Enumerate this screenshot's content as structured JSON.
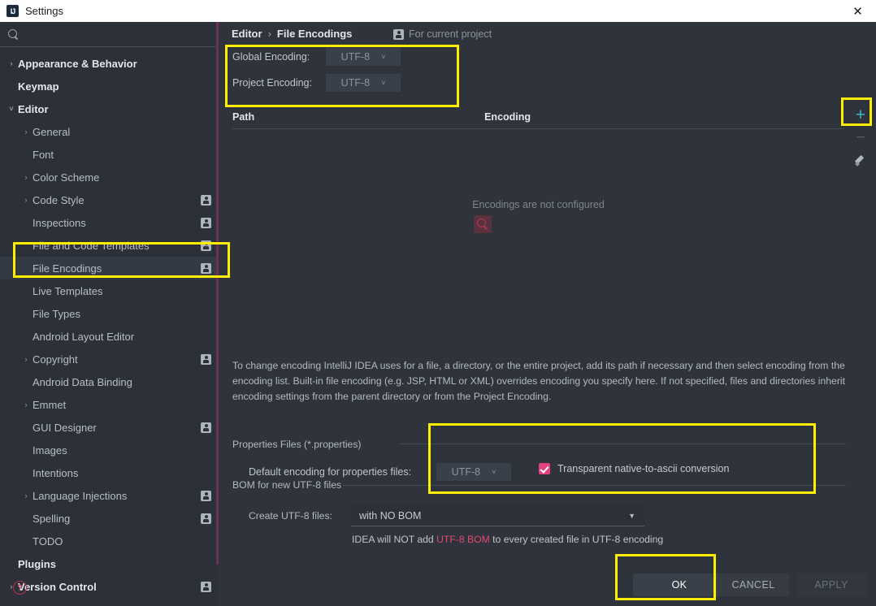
{
  "window": {
    "title": "Settings",
    "app_icon": "intellij-idea-icon",
    "close_icon": "close-icon"
  },
  "sidebar": {
    "search": {
      "value": "",
      "placeholder": "",
      "icon": "search-icon"
    },
    "items": [
      {
        "label": "Appearance & Behavior",
        "level": 0,
        "arrow": "›",
        "bold": true,
        "badge": false,
        "selected": false
      },
      {
        "label": "Keymap",
        "level": 0,
        "arrow": "",
        "bold": true,
        "badge": false,
        "selected": false
      },
      {
        "label": "Editor",
        "level": 0,
        "arrow": "˅",
        "bold": true,
        "badge": false,
        "selected": false
      },
      {
        "label": "General",
        "level": 1,
        "arrow": "›",
        "bold": false,
        "badge": false,
        "selected": false
      },
      {
        "label": "Font",
        "level": 1,
        "arrow": "",
        "bold": false,
        "badge": false,
        "selected": false
      },
      {
        "label": "Color Scheme",
        "level": 1,
        "arrow": "›",
        "bold": false,
        "badge": false,
        "selected": false
      },
      {
        "label": "Code Style",
        "level": 1,
        "arrow": "›",
        "bold": false,
        "badge": true,
        "selected": false
      },
      {
        "label": "Inspections",
        "level": 1,
        "arrow": "",
        "bold": false,
        "badge": true,
        "selected": false
      },
      {
        "label": "File and Code Templates",
        "level": 1,
        "arrow": "",
        "bold": false,
        "badge": true,
        "selected": false
      },
      {
        "label": "File Encodings",
        "level": 1,
        "arrow": "",
        "bold": false,
        "badge": true,
        "selected": true
      },
      {
        "label": "Live Templates",
        "level": 1,
        "arrow": "",
        "bold": false,
        "badge": false,
        "selected": false
      },
      {
        "label": "File Types",
        "level": 1,
        "arrow": "",
        "bold": false,
        "badge": false,
        "selected": false
      },
      {
        "label": "Android Layout Editor",
        "level": 1,
        "arrow": "",
        "bold": false,
        "badge": false,
        "selected": false
      },
      {
        "label": "Copyright",
        "level": 1,
        "arrow": "›",
        "bold": false,
        "badge": true,
        "selected": false
      },
      {
        "label": "Android Data Binding",
        "level": 1,
        "arrow": "",
        "bold": false,
        "badge": false,
        "selected": false
      },
      {
        "label": "Emmet",
        "level": 1,
        "arrow": "›",
        "bold": false,
        "badge": false,
        "selected": false
      },
      {
        "label": "GUI Designer",
        "level": 1,
        "arrow": "",
        "bold": false,
        "badge": true,
        "selected": false
      },
      {
        "label": "Images",
        "level": 1,
        "arrow": "",
        "bold": false,
        "badge": false,
        "selected": false
      },
      {
        "label": "Intentions",
        "level": 1,
        "arrow": "",
        "bold": false,
        "badge": false,
        "selected": false
      },
      {
        "label": "Language Injections",
        "level": 1,
        "arrow": "›",
        "bold": false,
        "badge": true,
        "selected": false
      },
      {
        "label": "Spelling",
        "level": 1,
        "arrow": "",
        "bold": false,
        "badge": true,
        "selected": false
      },
      {
        "label": "TODO",
        "level": 1,
        "arrow": "",
        "bold": false,
        "badge": false,
        "selected": false
      },
      {
        "label": "Plugins",
        "level": 0,
        "arrow": "",
        "bold": true,
        "badge": false,
        "selected": false
      },
      {
        "label": "Version Control",
        "level": 0,
        "arrow": "›",
        "bold": true,
        "badge": true,
        "selected": false
      }
    ],
    "help_icon": "help-icon",
    "help_glyph": "?"
  },
  "content": {
    "breadcrumb": {
      "parent": "Editor",
      "separator": "›",
      "current": "File Encodings"
    },
    "for_current_project": {
      "label": "For current project",
      "icon": "person-icon"
    },
    "global_encoding": {
      "label": "Global Encoding:",
      "value": "UTF-8",
      "chevron": "˅"
    },
    "project_encoding": {
      "label": "Project Encoding:",
      "value": "UTF-8",
      "chevron": "˅"
    },
    "table": {
      "columns": [
        "Path",
        "Encoding"
      ],
      "rows": [],
      "empty_message": "Encodings are not configured",
      "tools": [
        {
          "name": "add-encoding-button",
          "glyph": "+",
          "enabled": true
        },
        {
          "name": "remove-encoding-button",
          "glyph": "−",
          "enabled": false
        },
        {
          "name": "edit-encoding-button",
          "glyph": "pencil",
          "enabled": true
        }
      ]
    },
    "description": "To change encoding IntelliJ IDEA uses for a file, a directory, or the entire project, add its path if necessary and then select encoding from the encoding list. Built-in file encoding (e.g. JSP, HTML or XML) overrides encoding you specify here. If not specified, files and directories inherit encoding settings from the parent directory or from the Project Encoding.",
    "properties_group": {
      "title": "Properties Files (*.properties)",
      "default_encoding_label": "Default encoding for properties files:",
      "default_encoding_value": "UTF-8",
      "chevron": "˅",
      "checkbox_label": "Transparent native-to-ascii conversion",
      "checkbox_checked": true
    },
    "bom_group": {
      "title": "BOM for new UTF-8 files",
      "create_label": "Create UTF-8 files:",
      "create_value": "with NO BOM",
      "chevron": "▼",
      "note_prefix": "IDEA will NOT add ",
      "note_highlight": "UTF-8 BOM",
      "note_suffix": " to every created file in UTF-8 encoding"
    }
  },
  "footer": {
    "ok": "OK",
    "cancel": "CANCEL",
    "apply": "APPLY"
  },
  "colors": {
    "accent_yellow": "#ffee00",
    "teal_plus": "#3fb4c4",
    "pink_checkbox": "#e3427f",
    "red_text": "#e34a6f",
    "sidebar_divider": "#6e2f52"
  }
}
